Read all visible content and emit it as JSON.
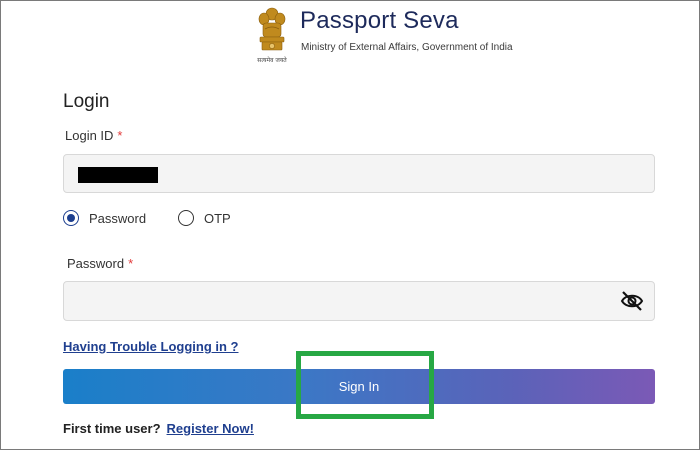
{
  "header": {
    "title": "Passport Seva",
    "subtitle": "Ministry of External Affairs, Government of India",
    "emblem_icon": "national-emblem-icon"
  },
  "login": {
    "heading": "Login",
    "login_id_label": "Login ID",
    "required_marker": "*",
    "login_id_value_masked": true,
    "auth_options": [
      "Password",
      "OTP"
    ],
    "selected_auth": "Password",
    "password_label": "Password",
    "password_value": "",
    "password_toggle_icon": "eye-slash-icon",
    "trouble_link": "Having Trouble Logging in ?",
    "signin_label": "Sign In",
    "first_time_text": "First time user?",
    "register_link": "Register Now!"
  },
  "colors": {
    "brand": "#1d2a5b",
    "link": "#1f3f8f",
    "required": "#e23a3a",
    "highlight": "#27a844",
    "button_start": "#1a7fc9",
    "button_end": "#7b59b6"
  }
}
